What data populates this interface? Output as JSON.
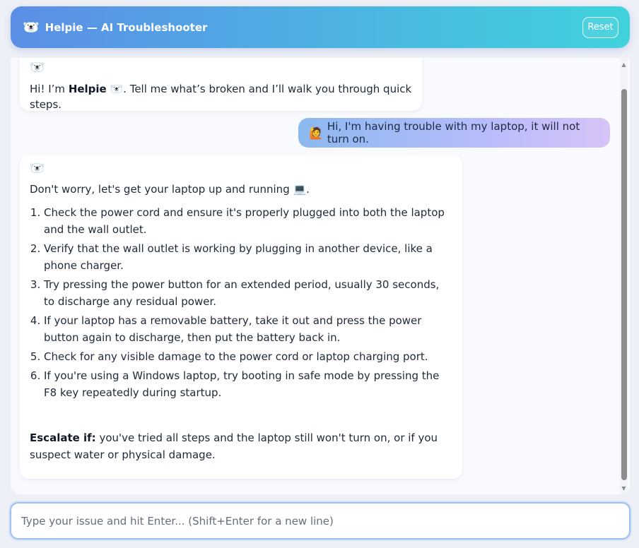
{
  "header": {
    "bot_emoji": "🐻‍❄️",
    "title": "Helpie — AI Troubleshooter",
    "reset_label": "Reset"
  },
  "messages": {
    "bot_greeting": {
      "icon": "🐻‍❄️",
      "prefix": "Hi! I’m ",
      "name": "Helpie",
      "suffix": " 🐻‍❄️. Tell me what’s broken and I’ll walk you through quick steps."
    },
    "user": {
      "emoji": "🙋",
      "text": "Hi, I'm having trouble with my laptop, it will not turn on."
    },
    "bot_reply": {
      "icon": "🐻‍❄️",
      "intro": "Don't worry, let's get your laptop up and running 💻.",
      "steps": [
        "Check the power cord and ensure it's properly plugged into both the laptop and the wall outlet.",
        "Verify that the wall outlet is working by plugging in another device, like a phone charger.",
        "Try pressing the power button for an extended period, usually 30 seconds, to discharge any residual power.",
        "If your laptop has a removable battery, take it out and press the power button again to discharge, then put the battery back in.",
        "Check for any visible damage to the power cord or laptop charging port.",
        "If you're using a Windows laptop, try booting in safe mode by pressing the F8 key repeatedly during startup."
      ],
      "escalate_label": "Escalate if:",
      "escalate_text": " you've tried all steps and the laptop still won't turn on, or if you suspect water or physical damage."
    }
  },
  "composer": {
    "placeholder": "Type your issue and hit Enter... (Shift+Enter for a new line)",
    "value": ""
  },
  "colors": {
    "header_gradient_start": "#5b8ee6",
    "header_gradient_end": "#3fd2dc",
    "user_bubble_start": "#8cb8f0",
    "user_bubble_end": "#d7c3f7"
  }
}
